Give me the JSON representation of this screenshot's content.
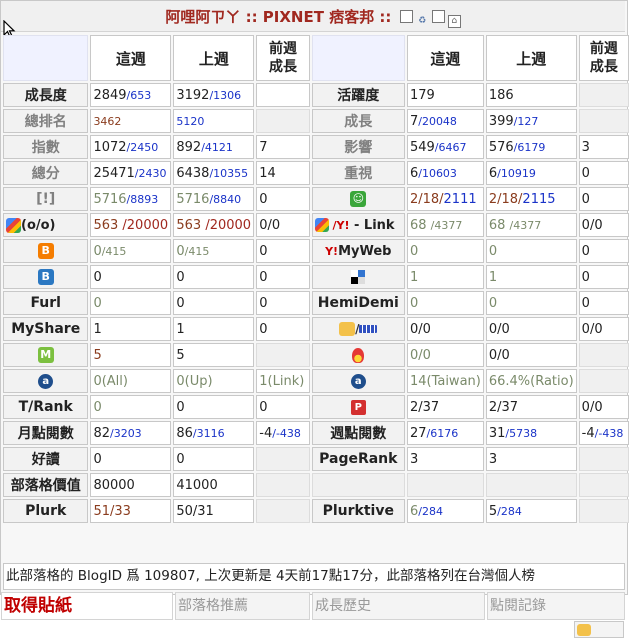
{
  "title": {
    "prefix": "阿哩阿ㄗㄚ",
    "sep1": " :: ",
    "site": "PIXNET 痞客邦",
    "sep2": " ::"
  },
  "headers": {
    "this_week": "這週",
    "last_week": "上週",
    "prev_growth_l1": "前週",
    "prev_growth_l2": "成長"
  },
  "rows": [
    {
      "left": {
        "label": "成長度",
        "muted": false,
        "tw": "2849",
        "tws": "/653",
        "lw": "3192",
        "lws": "/1306",
        "pg": ""
      },
      "right": {
        "label": "活躍度",
        "muted": false,
        "tw": "179",
        "tws": "",
        "lw": "186",
        "lws": "",
        "pg": ""
      }
    },
    {
      "left": {
        "label": "總排名",
        "muted": true,
        "tw": "",
        "tws": "3462",
        "lw": "",
        "lws": "5120",
        "pg": ""
      },
      "right": {
        "label": "成長",
        "muted": true,
        "tw": "7",
        "tws": "/20048",
        "lw": "399",
        "lws": "/127",
        "pg": ""
      }
    },
    {
      "left": {
        "label": "指數",
        "muted": true,
        "tw": "1072",
        "tws": "/2450",
        "lw": "892",
        "lws": "/4121",
        "pg": "7"
      },
      "right": {
        "label": "影響",
        "muted": true,
        "tw": "549",
        "tws": "/6467",
        "lw": "576",
        "lws": "/6179",
        "pg": "3"
      }
    },
    {
      "left": {
        "label": "總分",
        "muted": true,
        "tw": "25471",
        "tws": "/2430",
        "lw": "6438",
        "lws": "/10355",
        "pg": "14"
      },
      "right": {
        "label": "重視",
        "muted": true,
        "tw": "6",
        "tws": "/10603",
        "lw": "6",
        "lws": "/10919",
        "pg": "0"
      }
    }
  ],
  "row_excl": {
    "label": "[!]",
    "tw": "5716",
    "tws": "/8893",
    "lw": "5716",
    "lws": "/8840",
    "pg": "0",
    "rtw": "2/18/",
    "rtws": "2111",
    "rlw": "2/18/",
    "rlws": "2115",
    "rpg": "0"
  },
  "row_google": {
    "label": "(o/o)",
    "tw": "563 ",
    "tws": "/20000",
    "lw": "563 ",
    "lws": "/20000",
    "pg": "0/0",
    "rlabel": " - Link",
    "rtw": "68 ",
    "rtws": "/4377",
    "rlw": "68 ",
    "rlws": "/4377",
    "rpg": "0/0"
  },
  "row_blogger": {
    "tw": "0",
    "tws": "/415",
    "lw": "0",
    "lws": "/415",
    "pg": "0",
    "rlabel": "MyWeb",
    "rtw": "0",
    "rlw": "0",
    "rpg": "0"
  },
  "row_b": {
    "tw": "0",
    "lw": "0",
    "pg": "0",
    "rtw": "1",
    "rlw": "1",
    "rpg": "0"
  },
  "row_furl": {
    "label": "Furl",
    "tw": "0",
    "lw": "0",
    "pg": "0",
    "rlabel": "HemiDemi",
    "rtw": "0",
    "rlw": "0",
    "rpg": "0"
  },
  "row_myshare": {
    "label": "MyShare",
    "tw": "1",
    "lw": "1",
    "pg": "0",
    "rtw": "0/0",
    "rlw": "0/0",
    "rpg": "0/0"
  },
  "row_m": {
    "tw": "5",
    "lw": "5",
    "rtw": "0/0",
    "rlw": "0/0"
  },
  "row_alexa": {
    "tw": "0(All)",
    "lw": "0(Up)",
    "pg": "1(Link)",
    "rtw": "14(Taiwan)",
    "rlw": "66.4%(Ratio)"
  },
  "row_trank": {
    "label": "T/Rank",
    "tw": "0",
    "lw": "0",
    "pg": "0",
    "rtw": "2/37",
    "rlw": "2/37",
    "rpg": "0/0"
  },
  "row_monthly": {
    "label": "月點閱數",
    "tw": "82",
    "tws": "/3203",
    "lw": "86",
    "lws": "/3116",
    "pg": "-4",
    "pgs": "/-438",
    "rlabel": "週點閱數",
    "rtw": "27",
    "rtws": "/6176",
    "rlw": "31",
    "rlws": "/5738",
    "rpg": "-4",
    "rpgs": "/-438"
  },
  "row_fav": {
    "label": "好讀",
    "tw": "0",
    "lw": "0",
    "rlabel": "PageRank",
    "rtw": "3",
    "rlw": "3"
  },
  "row_value": {
    "label": "部落格價值",
    "tw": "80000",
    "lw": "41000"
  },
  "row_plurk": {
    "label": "Plurk",
    "tw": "51",
    "tws": "/33",
    "lw": "50",
    "lws": "/31",
    "rlabel": "Plurktive",
    "rtw": "6",
    "rtws": "/284",
    "rlw": "5",
    "rlws": "/284"
  },
  "footer_note": "此部落格的 BlogID 爲 109807, 上次更新是 4天前17點17分，此部落格列在台灣個人榜",
  "bottom_links": {
    "sticker": "取得貼紙",
    "recommend": "部落格推薦",
    "history": "成長歷史",
    "hits": "點閱記錄"
  },
  "colors": {
    "accent": "#a0281f",
    "link_blue": "#1a33c8",
    "muted": "#808080"
  },
  "icons": [
    "google-icon",
    "yahoo-icon",
    "blogger-icon",
    "bloglines-icon",
    "delicious-icon",
    "myshare-icon",
    "technorati-icon",
    "alexa-icon",
    "plurk-icon",
    "pixnet-icon",
    "funp-icon"
  ]
}
